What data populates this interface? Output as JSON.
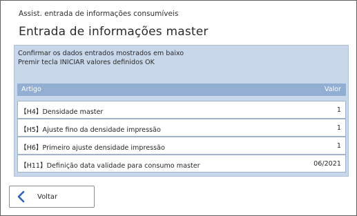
{
  "header": {
    "subtitle": "Assist. entrada de informações consumíveis",
    "title": "Entrada de informações master"
  },
  "instructions": {
    "line1": "Confirmar os dados entrados mostrados em baixo",
    "line2": "Premir tecla INICIAR valores definidos OK"
  },
  "table": {
    "columns": {
      "item": "Artigo",
      "value": "Valor"
    },
    "rows": [
      {
        "item": "【H4】Densidade master",
        "value": "1"
      },
      {
        "item": "【H5】Ajuste fino da densidade impressão",
        "value": "1"
      },
      {
        "item": "【H6】Primeiro ajuste densidade impressão",
        "value": "1"
      },
      {
        "item": "【H11】Definição data validade para consumo master",
        "value": "06/2021"
      }
    ]
  },
  "footer": {
    "back_label": "Voltar",
    "back_icon": "chevron-left-icon"
  },
  "colors": {
    "panel_background": "#c9d7ea",
    "header_background": "#93aed3",
    "icon_blue": "#2f63b3"
  }
}
